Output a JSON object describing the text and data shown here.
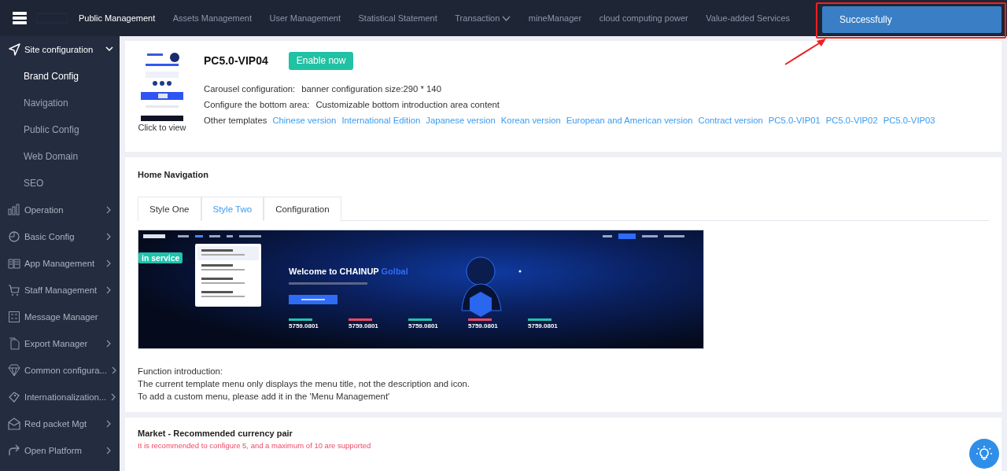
{
  "header": {
    "nav": [
      {
        "label": "Public Management",
        "selected": true,
        "dropdown": false
      },
      {
        "label": "Assets Management",
        "selected": false,
        "dropdown": false
      },
      {
        "label": "User Management",
        "selected": false,
        "dropdown": false
      },
      {
        "label": "Statistical Statement",
        "selected": false,
        "dropdown": false
      },
      {
        "label": "Transaction",
        "selected": false,
        "dropdown": true
      },
      {
        "label": "mineManager",
        "selected": false,
        "dropdown": false
      },
      {
        "label": "cloud computing power",
        "selected": false,
        "dropdown": false
      },
      {
        "label": "Value-added Services",
        "selected": false,
        "dropdown": false
      }
    ],
    "toast": "Successfully"
  },
  "sidebar": {
    "items": [
      {
        "label": "Site configuration",
        "expandable": true,
        "expanded": true,
        "children": [
          {
            "label": "Brand Config",
            "selected": true
          },
          {
            "label": "Navigation",
            "selected": false
          },
          {
            "label": "Public Config",
            "selected": false
          },
          {
            "label": "Web Domain",
            "selected": false
          },
          {
            "label": "SEO",
            "selected": false
          }
        ]
      },
      {
        "label": "Operation",
        "expandable": true,
        "expanded": false
      },
      {
        "label": "Basic Config",
        "expandable": true,
        "expanded": false
      },
      {
        "label": "App Management",
        "expandable": true,
        "expanded": false
      },
      {
        "label": "Staff Management",
        "expandable": true,
        "expanded": false
      },
      {
        "label": "Message Manager",
        "expandable": false,
        "expanded": false
      },
      {
        "label": "Export Manager",
        "expandable": true,
        "expanded": false
      },
      {
        "label": "Common configura...",
        "expandable": true,
        "expanded": false
      },
      {
        "label": "Internationalization...",
        "expandable": true,
        "expanded": false
      },
      {
        "label": "Red packet Mgt",
        "expandable": true,
        "expanded": false
      },
      {
        "label": "Open Platform",
        "expandable": true,
        "expanded": false
      }
    ]
  },
  "template": {
    "preview_link": "Click to view",
    "title": "PC5.0-VIP04",
    "enable_button": "Enable now",
    "rows": [
      {
        "label": "Carousel configuration:",
        "value": "banner configuration size:290 * 140"
      },
      {
        "label": "Configure the bottom area:",
        "value": "Customizable bottom introduction area content"
      }
    ],
    "other_label": "Other templates",
    "other_templates": [
      "Chinese version",
      "International Edition",
      "Japanese version",
      "Korean version",
      "European and American version",
      "Contract version",
      "PC5.0-VIP01",
      "PC5.0-VIP02",
      "PC5.0-VIP03"
    ]
  },
  "home_navigation": {
    "title": "Home Navigation",
    "tabs": [
      {
        "label": "Style One",
        "selected": false
      },
      {
        "label": "Style Two",
        "selected": true
      },
      {
        "label": "Configuration",
        "selected": false
      }
    ],
    "preview": {
      "badge": "in service",
      "headline": "Welcome to CHAINUP",
      "headline_accent": "Golbal",
      "tickers": [
        {
          "up": true,
          "price": "5759.0801"
        },
        {
          "up": false,
          "price": "5759.0801"
        },
        {
          "up": true,
          "price": "5759.0801"
        },
        {
          "up": false,
          "price": "5759.0801"
        },
        {
          "up": true,
          "price": "5759.0801"
        }
      ]
    },
    "intro": [
      "Function introduction:",
      "The current template menu only displays the menu title, not the description and icon.",
      "To add a custom menu, please add it in the 'Menu Management'"
    ]
  },
  "market": {
    "title": "Market - Recommended currency pair",
    "note": "It is recommended to configure 5, and a maximum of 10 are supported"
  }
}
